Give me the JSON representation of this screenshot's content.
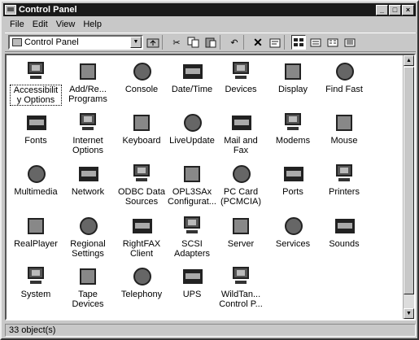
{
  "window": {
    "title": "Control Panel",
    "controls": [
      "_",
      "□",
      "×"
    ]
  },
  "menu": [
    "File",
    "Edit",
    "View",
    "Help"
  ],
  "address": {
    "value": "Control Panel"
  },
  "toolbar": {
    "buttons": [
      "up-folder",
      "cut",
      "copy",
      "paste",
      "undo",
      "delete",
      "properties",
      "large-icons",
      "small-icons",
      "list",
      "details"
    ]
  },
  "items": [
    {
      "label": "Accessibilit\ny Options",
      "icon": "accessibility-icon"
    },
    {
      "label": "Add/Re...\nPrograms",
      "icon": "add-remove-programs-icon"
    },
    {
      "label": "Console",
      "icon": "console-icon"
    },
    {
      "label": "Date/Time",
      "icon": "date-time-icon"
    },
    {
      "label": "Devices",
      "icon": "devices-icon"
    },
    {
      "label": "Display",
      "icon": "display-icon"
    },
    {
      "label": "Find Fast",
      "icon": "find-fast-icon"
    },
    {
      "label": "Fonts",
      "icon": "fonts-icon"
    },
    {
      "label": "Internet\nOptions",
      "icon": "internet-options-icon"
    },
    {
      "label": "Keyboard",
      "icon": "keyboard-icon"
    },
    {
      "label": "LiveUpdate",
      "icon": "liveupdate-icon"
    },
    {
      "label": "Mail and\nFax",
      "icon": "mail-fax-icon"
    },
    {
      "label": "Modems",
      "icon": "modems-icon"
    },
    {
      "label": "Mouse",
      "icon": "mouse-icon"
    },
    {
      "label": "Multimedia",
      "icon": "multimedia-icon"
    },
    {
      "label": "Network",
      "icon": "network-icon"
    },
    {
      "label": "ODBC Data\nSources",
      "icon": "odbc-icon"
    },
    {
      "label": "OPL3SAx\nConfigurat...",
      "icon": "opl3sax-icon"
    },
    {
      "label": "PC Card\n(PCMCIA)",
      "icon": "pc-card-icon"
    },
    {
      "label": "Ports",
      "icon": "ports-icon"
    },
    {
      "label": "Printers",
      "icon": "printers-icon"
    },
    {
      "label": "RealPlayer",
      "icon": "realplayer-icon"
    },
    {
      "label": "Regional\nSettings",
      "icon": "regional-settings-icon"
    },
    {
      "label": "RightFAX\nClient",
      "icon": "rightfax-icon"
    },
    {
      "label": "SCSI\nAdapters",
      "icon": "scsi-icon"
    },
    {
      "label": "Server",
      "icon": "server-icon"
    },
    {
      "label": "Services",
      "icon": "services-icon"
    },
    {
      "label": "Sounds",
      "icon": "sounds-icon"
    },
    {
      "label": "System",
      "icon": "system-icon"
    },
    {
      "label": "Tape\nDevices",
      "icon": "tape-devices-icon"
    },
    {
      "label": "Telephony",
      "icon": "telephony-icon"
    },
    {
      "label": "UPS",
      "icon": "ups-icon"
    },
    {
      "label": "WildTan...\nControl P...",
      "icon": "wildtangent-icon"
    }
  ],
  "status": {
    "text": "33 object(s)"
  }
}
